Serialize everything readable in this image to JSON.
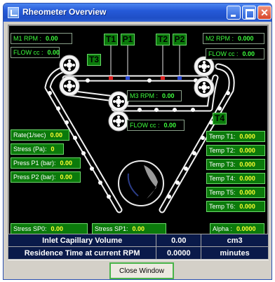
{
  "window": {
    "title": "Rheometer Overview"
  },
  "motors": {
    "m1": {
      "label": "M1 RPM :",
      "value": "0.00"
    },
    "m2": {
      "label": "M2 RPM :",
      "value": "0.000"
    },
    "m3": {
      "label": "M3 RPM :",
      "value": "0.00"
    }
  },
  "flows": {
    "left": {
      "label": "FLOW cc :",
      "value": "0.00"
    },
    "right": {
      "label": "FLOW cc :",
      "value": "0.00"
    },
    "center": {
      "label": "FLOW cc :",
      "value": "0.00"
    }
  },
  "tags": {
    "t1": "T1",
    "p1": "P1",
    "t2": "T2",
    "p2": "P2",
    "t3": "T3",
    "t4": "T4"
  },
  "left_readouts": [
    {
      "label": "Rate(1/sec)",
      "value": "0.00"
    },
    {
      "label": "Stress (Pa):",
      "value": "0"
    },
    {
      "label": "Press P1 (bar):",
      "value": "0.00"
    },
    {
      "label": "Press P2 (bar):",
      "value": "0.00"
    }
  ],
  "temps": [
    {
      "label": "Temp T1:",
      "value": "0.000"
    },
    {
      "label": "Temp T2:",
      "value": "0.000"
    },
    {
      "label": "Temp T3:",
      "value": "0.000"
    },
    {
      "label": "Temp T4:",
      "value": "0.000"
    },
    {
      "label": "Temp T5:",
      "value": "0.000"
    },
    {
      "label": "Temp T6:",
      "value": "0.000"
    }
  ],
  "setpoints": {
    "sp0": {
      "label": "Stress SP0:",
      "value": "0.00"
    },
    "sp1": {
      "label": "Stress SP1:",
      "value": "0.00"
    },
    "alpha": {
      "label": "Alpha :",
      "value": "0.0000"
    }
  },
  "info_table": [
    {
      "label": "Inlet Capillary Volume",
      "value": "0.00",
      "unit": "cm3"
    },
    {
      "label": "Residence Time at current RPM",
      "value": "0.0000",
      "unit": "minutes"
    }
  ],
  "footer": {
    "close_label": "Close Window"
  },
  "colors": {
    "panel_bg": "#000000",
    "label_green": "#3dff3d",
    "box_green": "#0b7a0b",
    "value_yellow": "#ffff30",
    "table_bg": "#0a1a4a"
  }
}
